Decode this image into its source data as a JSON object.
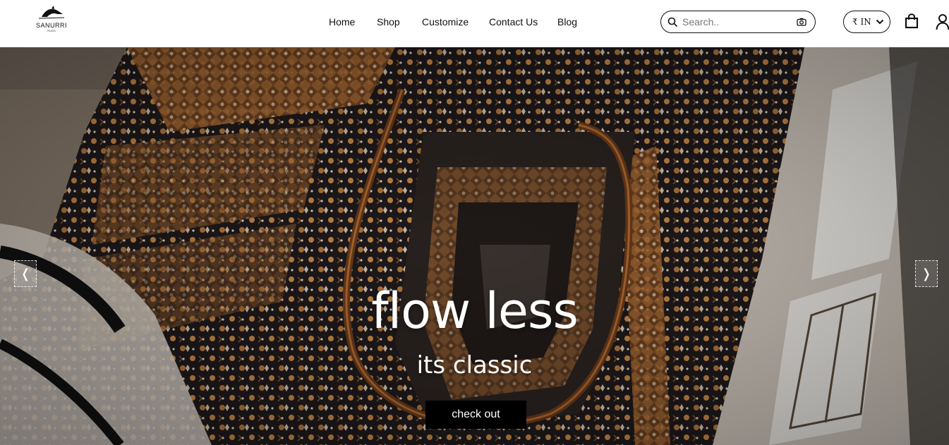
{
  "brand": {
    "name": "SANURRI",
    "sub": "RUGS"
  },
  "nav": {
    "items": [
      {
        "label": "Home"
      },
      {
        "label": "Shop"
      },
      {
        "label": "Customize"
      },
      {
        "label": "Contact Us"
      },
      {
        "label": "Blog"
      }
    ]
  },
  "search": {
    "placeholder": "Search..",
    "value": ""
  },
  "currency": {
    "selected": "₹ IN"
  },
  "icons": {
    "search": "search-icon",
    "camera": "camera-icon",
    "bag": "shopping-bag-icon",
    "user": "user-icon",
    "prev": "chevron-left-icon",
    "next": "chevron-right-icon"
  },
  "hero": {
    "title": "flow less",
    "subtitle": "its classic",
    "cta_label": "check out",
    "prev_glyph": "❬",
    "next_glyph": "❭"
  },
  "colors": {
    "cta_bg": "#000000",
    "hero_text": "#ffffff"
  }
}
